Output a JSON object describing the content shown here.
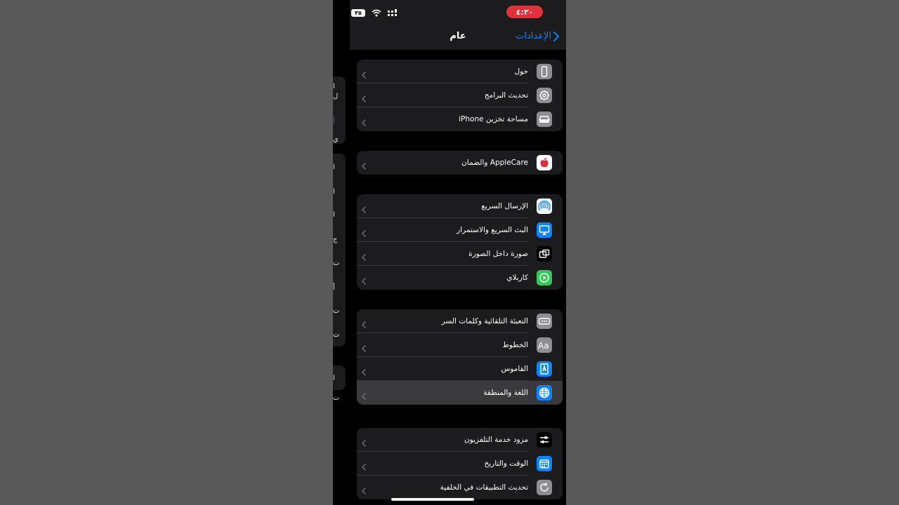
{
  "status_bar": {
    "time": "٤:٣٠",
    "battery": "٣٥"
  },
  "nav": {
    "title": "عام",
    "back_label": "الإعدادات"
  },
  "prev_screen_fragments": [
    "ا",
    "ل",
    "إ",
    "ي",
    "ا",
    "ا",
    "ا",
    "ج",
    "ت",
    "أ",
    "ت",
    "ت",
    "ا",
    "ت"
  ],
  "groups": [
    {
      "rows": [
        {
          "label": "حول",
          "icon": "phone-icon",
          "color": "#8e8e93"
        },
        {
          "label": "تحديث البرامج",
          "icon": "gear-icon",
          "color": "#8e8e93"
        },
        {
          "label": "مساحة تخزين iPhone",
          "icon": "storage-icon",
          "color": "#8e8e93"
        }
      ]
    },
    {
      "rows": [
        {
          "label": "AppleCare والضمان",
          "icon": "apple-icon",
          "color": "#ffffff"
        }
      ]
    },
    {
      "rows": [
        {
          "label": "الإرسال السريع",
          "icon": "airdrop-icon",
          "color": "#ffffff"
        },
        {
          "label": "البث السريع والاستمرار",
          "icon": "airplay-icon",
          "color": "#0a84ff"
        },
        {
          "label": "صورة داخل الصورة",
          "icon": "pip-icon",
          "color": "#000000"
        },
        {
          "label": "كاربلاي",
          "icon": "carplay-icon",
          "color": "#34c759"
        }
      ]
    },
    {
      "rows": [
        {
          "label": "التعبئة التلقائية وكلمات السر",
          "icon": "autofill-icon",
          "color": "#8e8e93"
        },
        {
          "label": "الخطوط",
          "icon": "fonts-icon",
          "color": "#8e8e93"
        },
        {
          "label": "القاموس",
          "icon": "dictionary-icon",
          "color": "#0a84ff"
        },
        {
          "label": "اللغة والمنطقة",
          "icon": "globe-icon",
          "color": "#0a84ff",
          "selected": true
        }
      ]
    },
    {
      "rows": [
        {
          "label": "مزود خدمة التلفزيون",
          "icon": "tv-provider-icon",
          "color": "#000000"
        },
        {
          "label": "الوقت والتاريخ",
          "icon": "calendar-icon",
          "color": "#0a84ff"
        },
        {
          "label": "تحديث التطبيقات في الخلفية",
          "icon": "refresh-icon",
          "color": "#8e8e93"
        }
      ]
    }
  ]
}
